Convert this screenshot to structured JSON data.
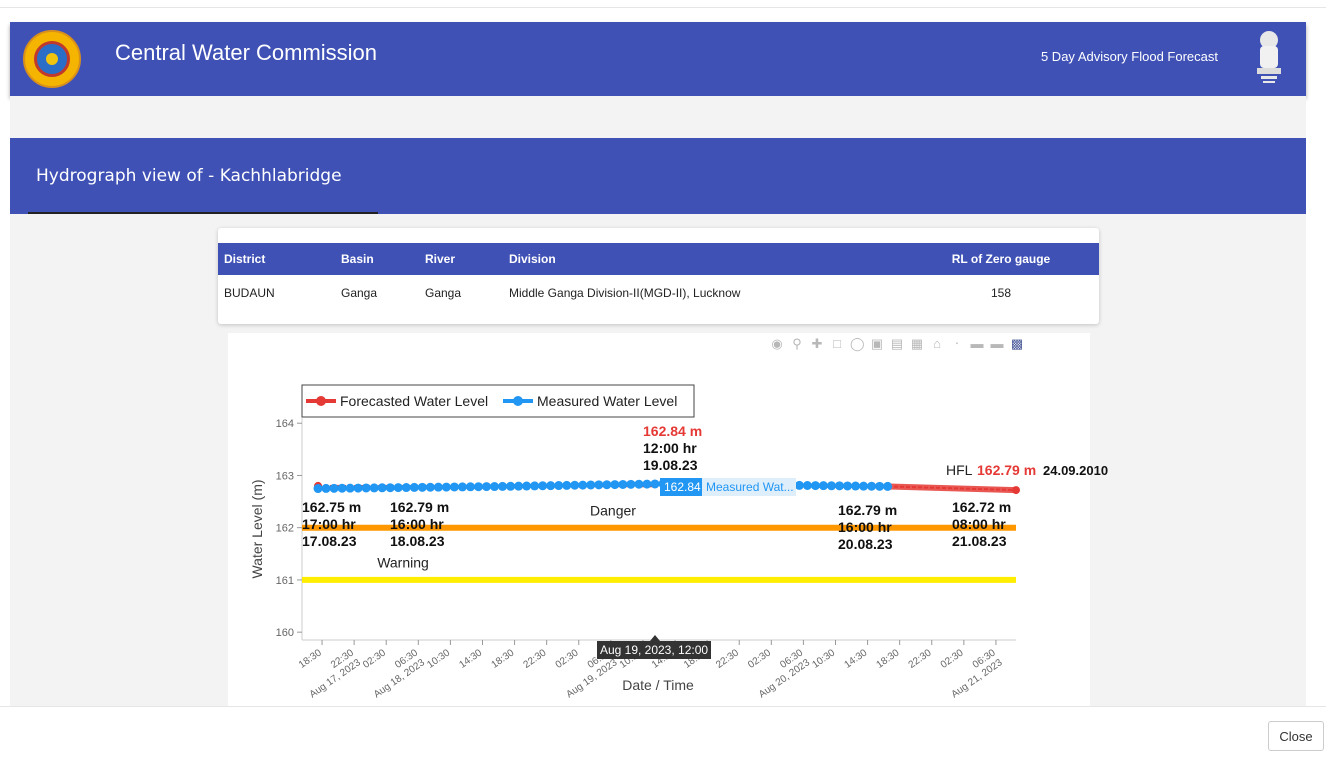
{
  "header": {
    "title": "Central Water Commission",
    "subtitle": "5 Day Advisory Flood Forecast"
  },
  "section": {
    "heading": "Hydrograph view of - Kachhlabridge"
  },
  "station_table": {
    "columns": [
      "District",
      "Basin",
      "River",
      "Division",
      "RL of Zero gauge"
    ],
    "rows": [
      [
        "BUDAUN",
        "Ganga",
        "Ganga",
        "Middle Ganga Division-II(MGD-II), Lucknow",
        "158"
      ]
    ]
  },
  "modebar": {
    "icons": [
      "camera-icon",
      "zoom-icon",
      "pan-icon",
      "box-select-icon",
      "lasso-icon",
      "zoom-in-icon",
      "zoom-out-icon",
      "autoscale-icon",
      "home-icon",
      "spike-icon",
      "hover-closest-icon",
      "hover-compare-icon",
      "plotly-logo-icon"
    ]
  },
  "footer": {
    "close_label": "Close"
  },
  "chart_data": {
    "type": "line",
    "xlabel": "Date / Time",
    "ylabel": "Water Level (m)",
    "ylim": [
      159.85,
      164.1
    ],
    "yticks": [
      160,
      161,
      162,
      163,
      164
    ],
    "x_axis": {
      "type": "date",
      "tick_labels": [
        "18:30",
        "Aug 17, 2023 22:30",
        "02:30",
        "Aug 18, 2023 06:30",
        "10:30",
        "14:30",
        "18:30",
        "22:30",
        "02:30",
        "Aug 19, 2023 06:30",
        "10:30",
        "14:30",
        "18:30",
        "22:30",
        "02:30",
        "Aug 20, 2023 06:30",
        "10:30",
        "14:30",
        "18:30",
        "22:30",
        "02:30",
        "Aug 21, 2023 06:30"
      ],
      "tick_hours": [
        1.5,
        5.5,
        9.5,
        13.5,
        17.5,
        21.5,
        25.5,
        29.5,
        33.5,
        37.5,
        41.5,
        45.5,
        49.5,
        53.5,
        57.5,
        61.5,
        65.5,
        69.5,
        73.5,
        77.5,
        81.5,
        85.5
      ]
    },
    "legend": {
      "placement": "top-left",
      "entries": [
        "Forecasted Water Level",
        "Measured Water Level"
      ]
    },
    "series": [
      {
        "name": "Measured Water Level",
        "color": "#2196f3",
        "start": "Aug 17, 2023 17:00",
        "end": "Aug 20, 2023 16:00",
        "points_hourly": true,
        "key_points": [
          {
            "t": "Aug 17, 2023 17:00",
            "y": 162.75
          },
          {
            "t": "Aug 18, 2023 16:00",
            "y": 162.79
          },
          {
            "t": "Aug 19, 2023 12:00",
            "y": 162.84
          },
          {
            "t": "Aug 20, 2023 16:00",
            "y": 162.79
          }
        ]
      },
      {
        "name": "Forecasted Water Level",
        "color": "#e53935",
        "start": "Aug 17, 2023 17:00",
        "end": "Aug 21, 2023 08:00",
        "key_points": [
          {
            "t": "Aug 17, 2023 17:00",
            "y": 162.8
          },
          {
            "t": "Aug 20, 2023 16:00",
            "y": 162.79
          },
          {
            "t": "Aug 21, 2023 08:00",
            "y": 162.72
          }
        ]
      }
    ],
    "reference_lines": [
      {
        "name": "Danger",
        "y": 162.0,
        "color": "#ff9800"
      },
      {
        "name": "Warning",
        "y": 161.0,
        "color": "#ffee00"
      },
      {
        "name": "HFL",
        "y": 162.79,
        "color": "#e53935"
      }
    ],
    "annotations": [
      {
        "value": "162.75 m",
        "time": "17:00 hr",
        "date": "17.08.23"
      },
      {
        "value": "162.79 m",
        "time": "16:00 hr",
        "date": "18.08.23"
      },
      {
        "value": "162.84 m",
        "time": "12:00 hr",
        "date": "19.08.23",
        "highlight": true
      },
      {
        "value": "162.79 m",
        "time": "16:00 hr",
        "date": "20.08.23"
      },
      {
        "value": "162.72 m",
        "time": "08:00 hr",
        "date": "21.08.23"
      }
    ],
    "hfl": {
      "label": "HFL",
      "value": "162.79 m",
      "date": "24.09.2010"
    },
    "danger_label": "Danger",
    "warning_label": "Warning",
    "hover": {
      "x_label": "Aug 19, 2023, 12:00",
      "y_value": "162.84",
      "series_label": "Measured Wat..."
    }
  }
}
